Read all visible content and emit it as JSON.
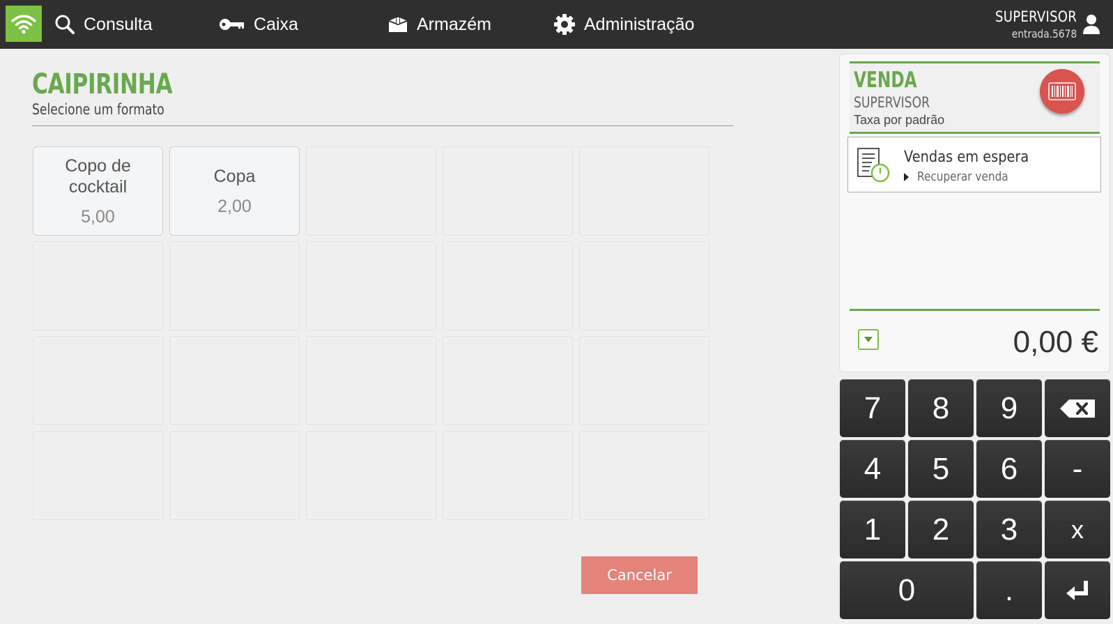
{
  "nav": {
    "wifi_icon": "wifi-icon",
    "items": [
      {
        "label": "Consulta",
        "icon": "search-icon"
      },
      {
        "label": "Caixa",
        "icon": "key-icon"
      },
      {
        "label": "Armazém",
        "icon": "box-icon"
      },
      {
        "label": "Administração",
        "icon": "gear-icon"
      }
    ],
    "user": {
      "name": "SUPERVISOR",
      "login": "entrada.5678",
      "icon": "user-icon"
    }
  },
  "product": {
    "title": "CAIPIRINHA",
    "subtitle": "Selecione um formato",
    "formats": [
      {
        "name": "Copo de cocktail",
        "price": "5,00"
      },
      {
        "name": "Copa",
        "price": "2,00"
      }
    ]
  },
  "actions": {
    "cancel_label": "Cancelar"
  },
  "sale": {
    "title": "VENDA",
    "user": "SUPERVISOR",
    "tax": "Taxa por padrão",
    "barcode_icon": "barcode-icon",
    "held": {
      "title": "Vendas em espera",
      "subtitle": "Recuperar venda",
      "icon": "held-sales-icon"
    },
    "total": "0,00 €"
  },
  "keypad": {
    "keys": [
      "7",
      "8",
      "9",
      "⌫",
      "4",
      "5",
      "6",
      "-",
      "1",
      "2",
      "3",
      "x",
      "0",
      ".",
      "↵"
    ]
  },
  "colors": {
    "accent": "#6aa84f",
    "wifi": "#7dc142",
    "cancel": "#e4837a",
    "barcode": "#d9534f",
    "topbar": "#2f2f2f"
  }
}
